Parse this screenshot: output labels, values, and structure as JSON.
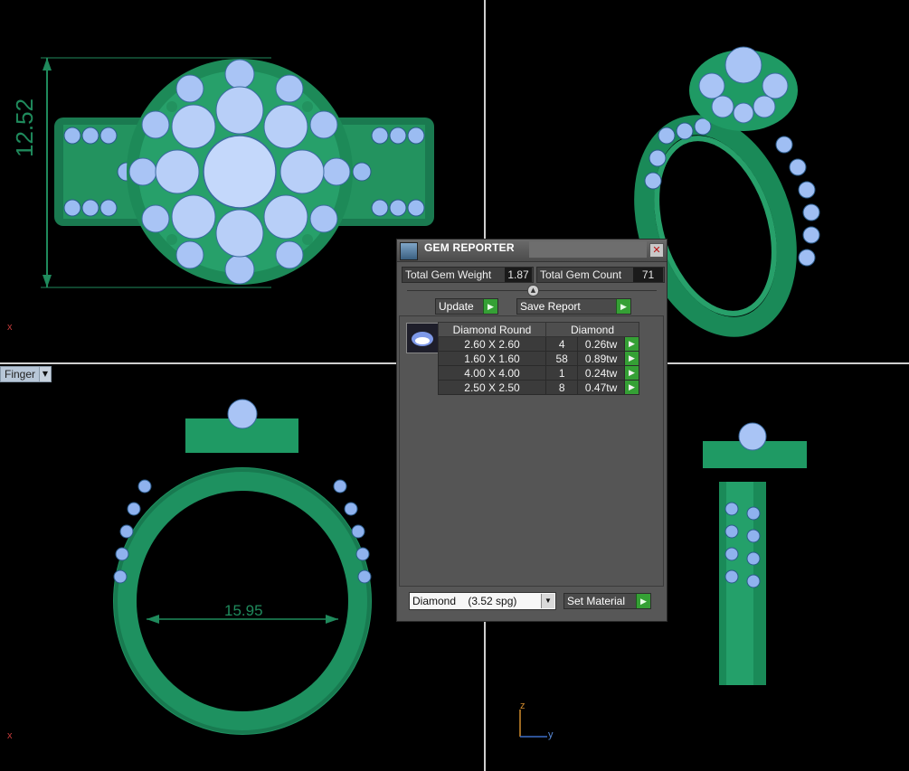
{
  "viewports": {
    "top_left": {
      "dimension": "12.52",
      "axis_label": "x"
    },
    "bottom_left": {
      "dimension": "15.95",
      "axis_label": "x",
      "view_mode": "Finger"
    },
    "bottom_right": {
      "axis_z": "z",
      "axis_y": "y"
    }
  },
  "gem_reporter": {
    "title": "GEM REPORTER",
    "total_weight_label": "Total Gem Weight",
    "total_weight_value": "1.87",
    "total_count_label": "Total Gem Count",
    "total_count_value": "71",
    "update_label": "Update",
    "save_report_label": "Save Report",
    "table_header_shape": "Diamond Round",
    "table_header_type": "Diamond",
    "rows": [
      {
        "size": "2.60 X 2.60",
        "count": "4",
        "weight": "0.26tw"
      },
      {
        "size": "1.60 X 1.60",
        "count": "58",
        "weight": "0.89tw"
      },
      {
        "size": "4.00 X 4.00",
        "count": "1",
        "weight": "0.24tw"
      },
      {
        "size": "2.50 X 2.50",
        "count": "8",
        "weight": "0.47tw"
      }
    ],
    "material_select_value": "Diamond    (3.52 spg)",
    "set_material_label": "Set Material"
  },
  "colors": {
    "metal": "#1f9a68",
    "gem": "#8ab0f0",
    "accent_go": "#35a035"
  }
}
